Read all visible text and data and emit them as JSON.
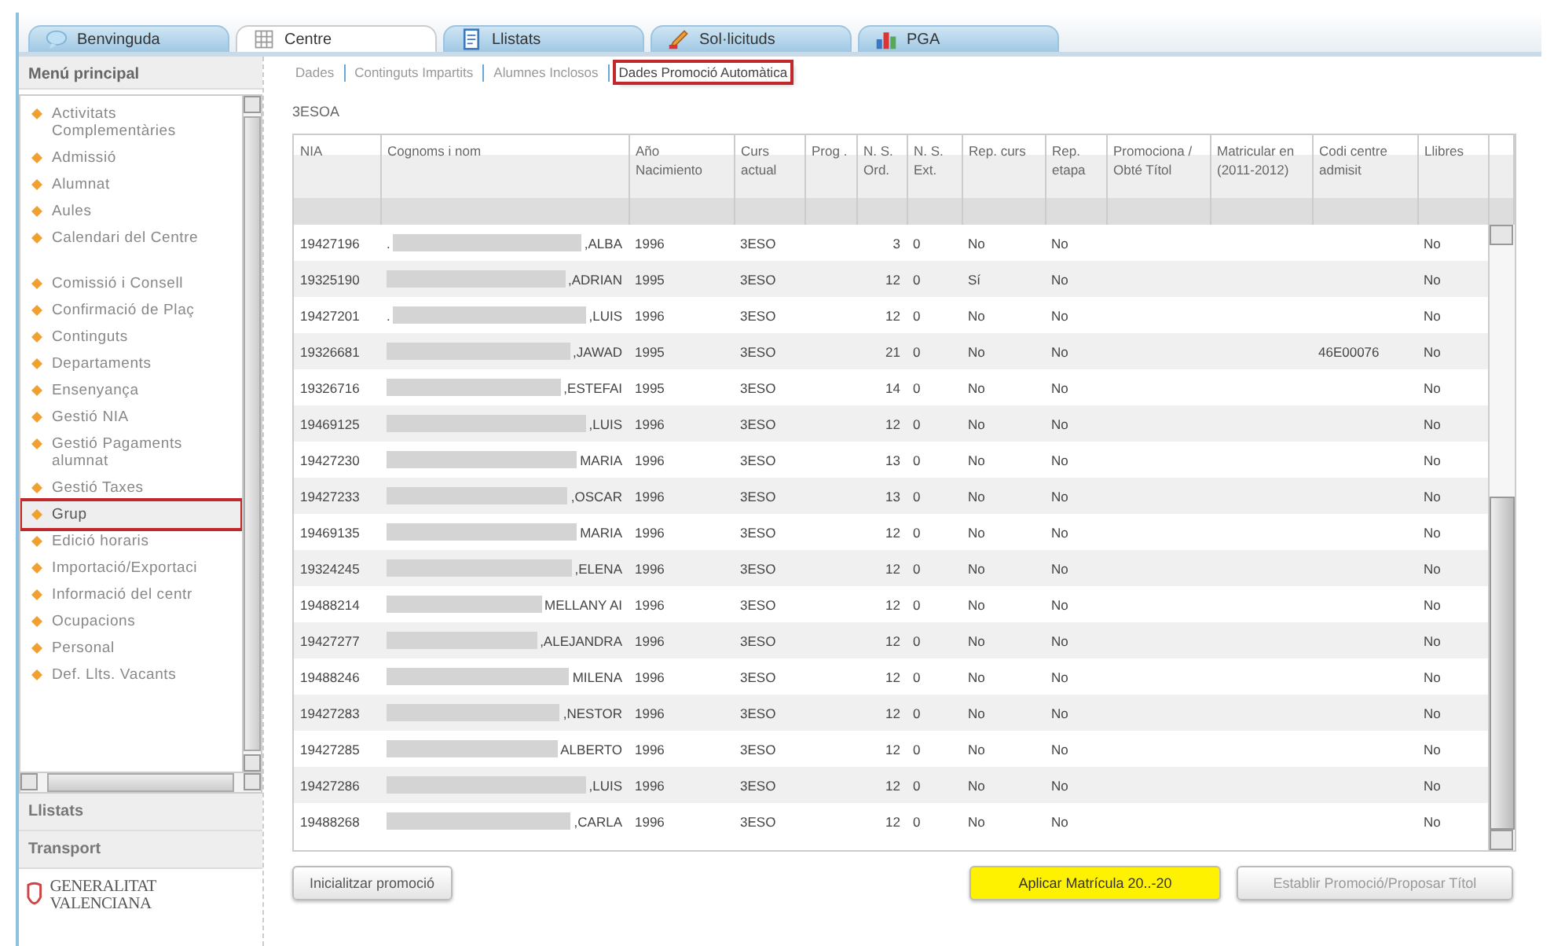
{
  "tabs": [
    {
      "label": "Benvinguda",
      "kind": "chat",
      "selected": false
    },
    {
      "label": "Centre",
      "kind": "grid",
      "selected": true
    },
    {
      "label": "Llistats",
      "kind": "doc",
      "selected": false
    },
    {
      "label": "Sol·licituds",
      "kind": "pen",
      "selected": false
    },
    {
      "label": "PGA",
      "kind": "chart",
      "selected": false
    }
  ],
  "sidebar": {
    "title": "Menú principal",
    "items": [
      {
        "label": "Activitats Complementàries",
        "selected": false
      },
      {
        "label": "Admissió",
        "selected": false
      },
      {
        "label": "Alumnat",
        "selected": false
      },
      {
        "label": "Aules",
        "selected": false
      },
      {
        "label": "Calendari del Centre",
        "selected": false
      },
      {
        "label": "Comissió i Consell",
        "selected": false
      },
      {
        "label": "Confirmació de Plaç",
        "selected": false
      },
      {
        "label": "Continguts",
        "selected": false
      },
      {
        "label": "Departaments",
        "selected": false
      },
      {
        "label": "Ensenyança",
        "selected": false
      },
      {
        "label": "Gestió NIA",
        "selected": false
      },
      {
        "label": "Gestió Pagaments alumnat",
        "selected": false
      },
      {
        "label": "Gestió Taxes",
        "selected": false
      },
      {
        "label": "Grup",
        "selected": true
      },
      {
        "label": "Edició horaris",
        "selected": false
      },
      {
        "label": "Importació/Exportaci",
        "selected": false
      },
      {
        "label": "Informació del centr",
        "selected": false
      },
      {
        "label": "Ocupacions",
        "selected": false
      },
      {
        "label": "Personal",
        "selected": false
      },
      {
        "label": "Def. Llts. Vacants",
        "selected": false
      }
    ],
    "sections": [
      "Llistats",
      "Transport"
    ],
    "logo": "GENERALITAT VALENCIANA"
  },
  "subtabs": [
    {
      "label": "Dades",
      "selected": false
    },
    {
      "label": "Continguts Impartits",
      "selected": false
    },
    {
      "label": "Alumnes Inclosos",
      "selected": false
    },
    {
      "label": "Dades Promoció Automàtica",
      "selected": true
    }
  ],
  "group": "3ESOA",
  "table": {
    "columns": [
      "NIA",
      "Cognoms i nom",
      "Año Nacimiento",
      "Curs actual",
      "Prog .",
      "N. S. Ord.",
      "N. S. Ext.",
      "Rep. curs",
      "Rep. etapa",
      "Promociona / Obté Títol",
      "Matricular en (2011-2012)",
      "Codi centre admisit",
      "Llibres"
    ],
    "rows": [
      {
        "nia": "19427196",
        "prefix": ".",
        "name": ",ALBA",
        "year": "1996",
        "course": "3ESO",
        "ord": "3",
        "ext": "0",
        "rep_curs": "No",
        "rep_etapa": "No",
        "llibres": "No"
      },
      {
        "nia": "19325190",
        "name": ",ADRIAN",
        "year": "1995",
        "course": "3ESO",
        "ord": "12",
        "ext": "0",
        "rep_curs": "Sí",
        "rep_etapa": "No",
        "llibres": "No"
      },
      {
        "nia": "19427201",
        "prefix": ".",
        "name": ",LUIS",
        "year": "1996",
        "course": "3ESO",
        "ord": "12",
        "ext": "0",
        "rep_curs": "No",
        "rep_etapa": "No",
        "llibres": "No"
      },
      {
        "nia": "19326681",
        "name": ",JAWAD",
        "year": "1995",
        "course": "3ESO",
        "ord": "21",
        "ext": "0",
        "rep_curs": "No",
        "rep_etapa": "No",
        "codi": "46E00076",
        "llibres": "No"
      },
      {
        "nia": "19326716",
        "name": ",ESTEFAI",
        "year": "1995",
        "course": "3ESO",
        "ord": "14",
        "ext": "0",
        "rep_curs": "No",
        "rep_etapa": "No",
        "llibres": "No"
      },
      {
        "nia": "19469125",
        "name": ",LUIS",
        "year": "1996",
        "course": "3ESO",
        "ord": "12",
        "ext": "0",
        "rep_curs": "No",
        "rep_etapa": "No",
        "llibres": "No"
      },
      {
        "nia": "19427230",
        "name": "MARIA",
        "year": "1996",
        "course": "3ESO",
        "ord": "13",
        "ext": "0",
        "rep_curs": "No",
        "rep_etapa": "No",
        "llibres": "No"
      },
      {
        "nia": "19427233",
        "name": ",OSCAR",
        "year": "1996",
        "course": "3ESO",
        "ord": "13",
        "ext": "0",
        "rep_curs": "No",
        "rep_etapa": "No",
        "llibres": "No"
      },
      {
        "nia": "19469135",
        "name": "MARIA",
        "year": "1996",
        "course": "3ESO",
        "ord": "12",
        "ext": "0",
        "rep_curs": "No",
        "rep_etapa": "No",
        "llibres": "No"
      },
      {
        "nia": "19324245",
        "name": ",ELENA",
        "year": "1996",
        "course": "3ESO",
        "ord": "12",
        "ext": "0",
        "rep_curs": "No",
        "rep_etapa": "No",
        "llibres": "No"
      },
      {
        "nia": "19488214",
        "name": "MELLANY AI",
        "year": "1996",
        "course": "3ESO",
        "ord": "12",
        "ext": "0",
        "rep_curs": "No",
        "rep_etapa": "No",
        "llibres": "No"
      },
      {
        "nia": "19427277",
        "name": ",ALEJANDRA",
        "year": "1996",
        "course": "3ESO",
        "ord": "12",
        "ext": "0",
        "rep_curs": "No",
        "rep_etapa": "No",
        "llibres": "No"
      },
      {
        "nia": "19488246",
        "name": "MILENA",
        "year": "1996",
        "course": "3ESO",
        "ord": "12",
        "ext": "0",
        "rep_curs": "No",
        "rep_etapa": "No",
        "llibres": "No"
      },
      {
        "nia": "19427283",
        "name": ",NESTOR",
        "year": "1996",
        "course": "3ESO",
        "ord": "12",
        "ext": "0",
        "rep_curs": "No",
        "rep_etapa": "No",
        "llibres": "No"
      },
      {
        "nia": "19427285",
        "name": "ALBERTO",
        "year": "1996",
        "course": "3ESO",
        "ord": "12",
        "ext": "0",
        "rep_curs": "No",
        "rep_etapa": "No",
        "llibres": "No"
      },
      {
        "nia": "19427286",
        "name": ",LUIS",
        "year": "1996",
        "course": "3ESO",
        "ord": "12",
        "ext": "0",
        "rep_curs": "No",
        "rep_etapa": "No",
        "llibres": "No"
      },
      {
        "nia": "19488268",
        "name": ",CARLA",
        "year": "1996",
        "course": "3ESO",
        "ord": "12",
        "ext": "0",
        "rep_curs": "No",
        "rep_etapa": "No",
        "llibres": "No"
      }
    ]
  },
  "buttons": [
    {
      "label": "Inicialitzar promoció",
      "kind": "normal",
      "disabled": false
    },
    {
      "label": "Aplicar Matrícula 20..-20",
      "kind": "highlight",
      "disabled": false
    },
    {
      "label": "Establir Promoció/Proposar Títol",
      "kind": "normal",
      "disabled": true
    }
  ]
}
